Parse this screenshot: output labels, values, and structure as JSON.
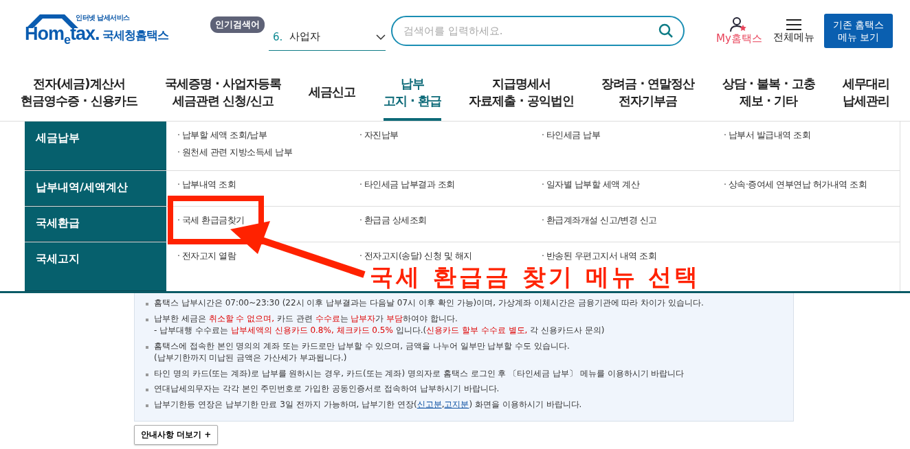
{
  "header": {
    "logo": {
      "tagline": "인터넷 납세서비스",
      "brand": "Hom$_{e}$tax.",
      "name": "국세청홈택스"
    },
    "popular_search": {
      "badge": "인기검색어",
      "rank": "6.",
      "term": "사업자"
    },
    "search": {
      "placeholder": "검색어를 입력하세요."
    },
    "my_hometax": "My홈택스",
    "all_menu": "전체메뉴",
    "legacy_button": [
      "기존 홈택스",
      "메뉴 보기"
    ]
  },
  "nav": [
    {
      "lines": [
        "전자(세금)계산서",
        "현금영수증 · 신용카드"
      ],
      "selected": false
    },
    {
      "lines": [
        "국세증명 · 사업자등록",
        "세금관련 신청/신고"
      ],
      "selected": false
    },
    {
      "lines": [
        "세금신고"
      ],
      "selected": false
    },
    {
      "lines": [
        "납부",
        "고지 · 환급"
      ],
      "selected": true
    },
    {
      "lines": [
        "지급명세서",
        "자료제출 · 공익법인"
      ],
      "selected": false
    },
    {
      "lines": [
        "장려금 · 연말정산",
        "전자기부금"
      ],
      "selected": false
    },
    {
      "lines": [
        "상담 · 불복 · 고충",
        "제보 · 기타"
      ],
      "selected": false
    },
    {
      "lines": [
        "세무대리",
        "납세관리"
      ],
      "selected": false
    }
  ],
  "submenu": [
    {
      "title": "세금납부",
      "items": [
        "· 납부할 세액 조회/납부",
        "· 자진납부",
        "· 타인세금 납부",
        "· 납부서 발급내역 조회",
        "· 원천세 관련 지방소득세 납부"
      ]
    },
    {
      "title": "납부내역/세액계산",
      "items": [
        "· 납부내역 조회",
        "· 타인세금 납부결과 조회",
        "· 일자별 납부할 세액 계산",
        "· 상속·증여세 연부연납 허가내역 조회"
      ]
    },
    {
      "title": "국세환급",
      "items": [
        "· 국세 환급금찾기",
        "· 환급금 상세조회",
        "· 환급계좌개설 신고/변경 신고"
      ]
    },
    {
      "title": "국세고지",
      "items": [
        "· 전자고지 열람",
        "· 전자고지(송달) 신청 및 해지",
        "· 반송된 우편고지서 내역 조회"
      ]
    }
  ],
  "notices": [
    {
      "lines": [
        [
          {
            "kind": "plain",
            "text": "홈택스 납부시간은 07:00~23:30 (22시 이후 납부결과는 다음날 07시 이후 확인 가능)이며, 가상계좌 이체시간은 금융기관에 따라 차이가 있습니다."
          }
        ]
      ]
    },
    {
      "lines": [
        [
          {
            "kind": "plain",
            "text": "납부한 세금은 "
          },
          {
            "kind": "red",
            "text": "취소할 수 없으며,"
          },
          {
            "kind": "plain",
            "text": " 카드 관련 "
          },
          {
            "kind": "red",
            "text": "수수료"
          },
          {
            "kind": "plain",
            "text": "는 "
          },
          {
            "kind": "red",
            "text": "납부자"
          },
          {
            "kind": "plain",
            "text": "가 "
          },
          {
            "kind": "red",
            "text": "부담"
          },
          {
            "kind": "plain",
            "text": "하여야 합니다."
          }
        ],
        [
          {
            "kind": "plain",
            "text": "- 납부대행 수수료는 "
          },
          {
            "kind": "red",
            "text": "납부세액의 신용카드 0.8%, 체크카드 0.5%"
          },
          {
            "kind": "plain",
            "text": " 입니다.("
          },
          {
            "kind": "red",
            "text": "신용카드 할부 수수료 별도,"
          },
          {
            "kind": "plain",
            "text": " 각 신용카드사 문의)"
          }
        ]
      ]
    },
    {
      "lines": [
        [
          {
            "kind": "plain",
            "text": "홈택스에 접속한 본인 명의의 계좌 또는 카드로만 납부할 수 있으며, 금액을 나누어 일부만 납부할 수도 있습니다."
          }
        ],
        [
          {
            "kind": "plain",
            "text": "(납부기한까지 미납된 금액은 가산세가 부과됩니다.)"
          }
        ]
      ]
    },
    {
      "lines": [
        [
          {
            "kind": "plain",
            "text": "타인 명의 카드(또는 계좌)로 납부를 원하시는 경우, 카드(또는 계좌) 명의자로 홈택스 로그인 후 〔타인세금 납부〕 메뉴를 이용하시기 바랍니다"
          }
        ]
      ]
    },
    {
      "lines": [
        [
          {
            "kind": "plain",
            "text": "연대납세의무자는 각각 본인 주민번호로 가입한 공동인증서로 접속하여 납부하시기 바랍니다."
          }
        ]
      ]
    },
    {
      "lines": [
        [
          {
            "kind": "plain",
            "text": "납부기한등 연장은 납부기한 만료 3일 전까지 가능하며, 납부기한 연장("
          },
          {
            "kind": "link",
            "text": "신고분"
          },
          {
            "kind": "plain",
            "text": ","
          },
          {
            "kind": "link",
            "text": "고지분"
          },
          {
            "kind": "plain",
            "text": ") 화면을 이용하시기 바랍니다."
          }
        ]
      ]
    }
  ],
  "more_button": "안내사항 더보기 +",
  "annotation": {
    "text": "국세 환급금 찾기 메뉴 선택"
  }
}
